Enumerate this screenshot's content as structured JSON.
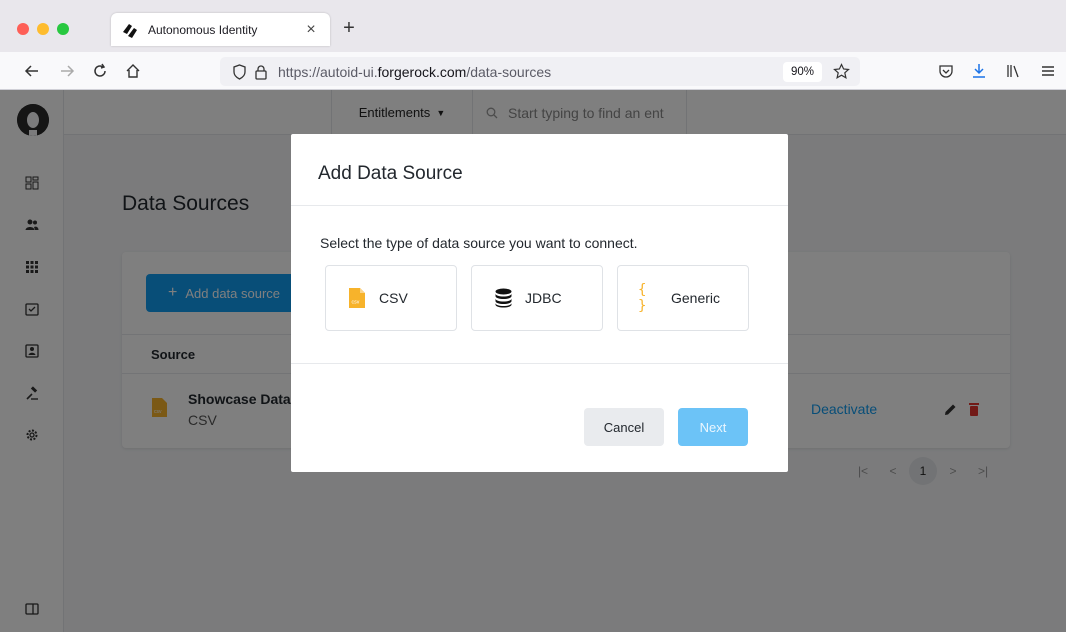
{
  "browser": {
    "tab_title": "Autonomous Identity",
    "new_tab_label": "+",
    "url_prefix": "https://autoid-ui.",
    "url_host": "forgerock.com",
    "url_path": "/data-sources",
    "zoom": "90%"
  },
  "app": {
    "entitlements_label": "Entitlements",
    "search_placeholder": "Start typing to find an ent",
    "page_title": "Data Sources",
    "add_button_label": "Add data source",
    "table": {
      "header_source": "Source",
      "rows": [
        {
          "name": "Showcase Data",
          "type": "CSV",
          "action": "Deactivate"
        }
      ]
    },
    "pagination": {
      "current_page": "1"
    }
  },
  "modal": {
    "title": "Add Data Source",
    "prompt": "Select the type of data source you want to connect.",
    "options": [
      {
        "label": "CSV",
        "icon": "csv-file-icon"
      },
      {
        "label": "JDBC",
        "icon": "database-icon"
      },
      {
        "label": "Generic",
        "icon": "braces-icon"
      }
    ],
    "cancel_label": "Cancel",
    "next_label": "Next"
  },
  "colors": {
    "primary": "#109cf1",
    "next_disabled": "#6cc3f7",
    "csv_icon": "#f7b32b",
    "delete_icon": "#e5352e"
  }
}
